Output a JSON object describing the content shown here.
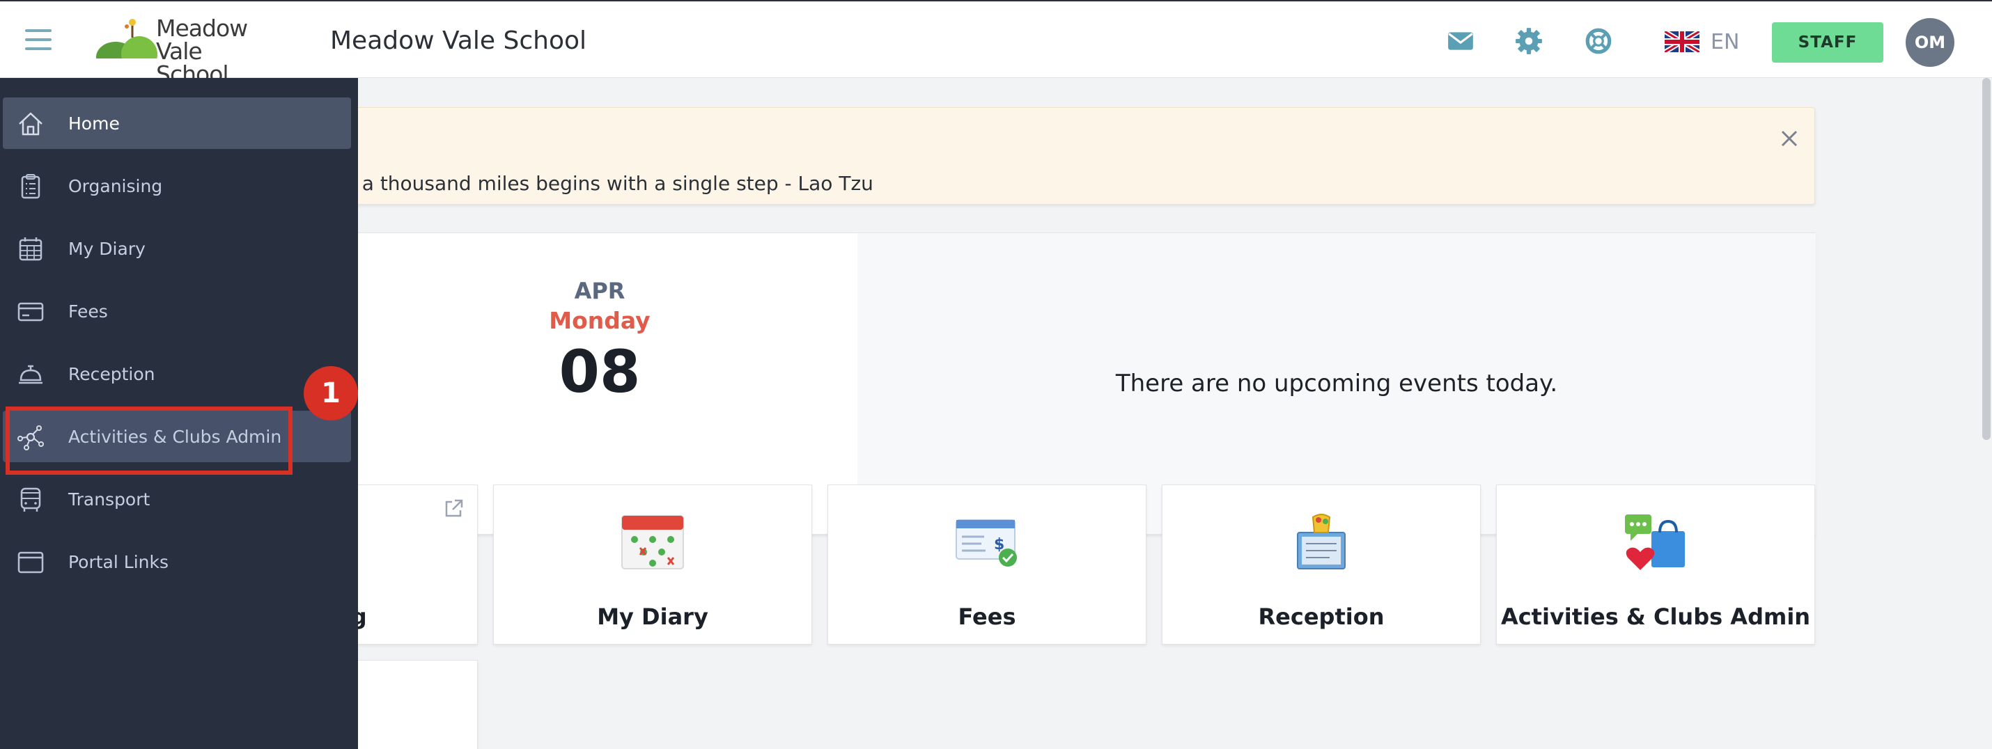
{
  "header": {
    "logo_line1": "Meadow",
    "logo_line2": "Vale School",
    "title": "Meadow Vale School",
    "icons": [
      "mail-icon",
      "gear-icon",
      "help-lifebuoy-icon"
    ],
    "language": "EN",
    "staff_label": "STAFF",
    "avatar_initials": "OM"
  },
  "sidebar": {
    "items": [
      {
        "label": "Home",
        "icon": "home-icon",
        "active": true
      },
      {
        "label": "Organising",
        "icon": "clipboard-icon"
      },
      {
        "label": "My Diary",
        "icon": "calendar-icon"
      },
      {
        "label": "Fees",
        "icon": "card-icon"
      },
      {
        "label": "Reception",
        "icon": "bell-icon"
      },
      {
        "label": "Activities & Clubs Admin",
        "icon": "network-icon",
        "highlighted": true
      },
      {
        "label": "Transport",
        "icon": "bus-icon"
      },
      {
        "label": "Portal Links",
        "icon": "window-icon"
      }
    ]
  },
  "quote": {
    "text": "f a thousand miles begins with a single step - Lao Tzu"
  },
  "date_card": {
    "month": "APR",
    "weekday": "Monday",
    "day": "08",
    "events_message": "There are no upcoming events today."
  },
  "tiles": [
    {
      "label": "ng"
    },
    {
      "label": "My Diary"
    },
    {
      "label": "Fees"
    },
    {
      "label": "Reception"
    },
    {
      "label": "Activities & Clubs Admin"
    }
  ],
  "annotation": {
    "number": "1"
  },
  "colors": {
    "sidebar_bg": "#283040",
    "sidebar_active": "#4b5569",
    "staff_green": "#6fdc95",
    "weekday_red": "#e05b4a",
    "annotation_red": "#d93025",
    "quote_bg": "#fdf5e7"
  }
}
